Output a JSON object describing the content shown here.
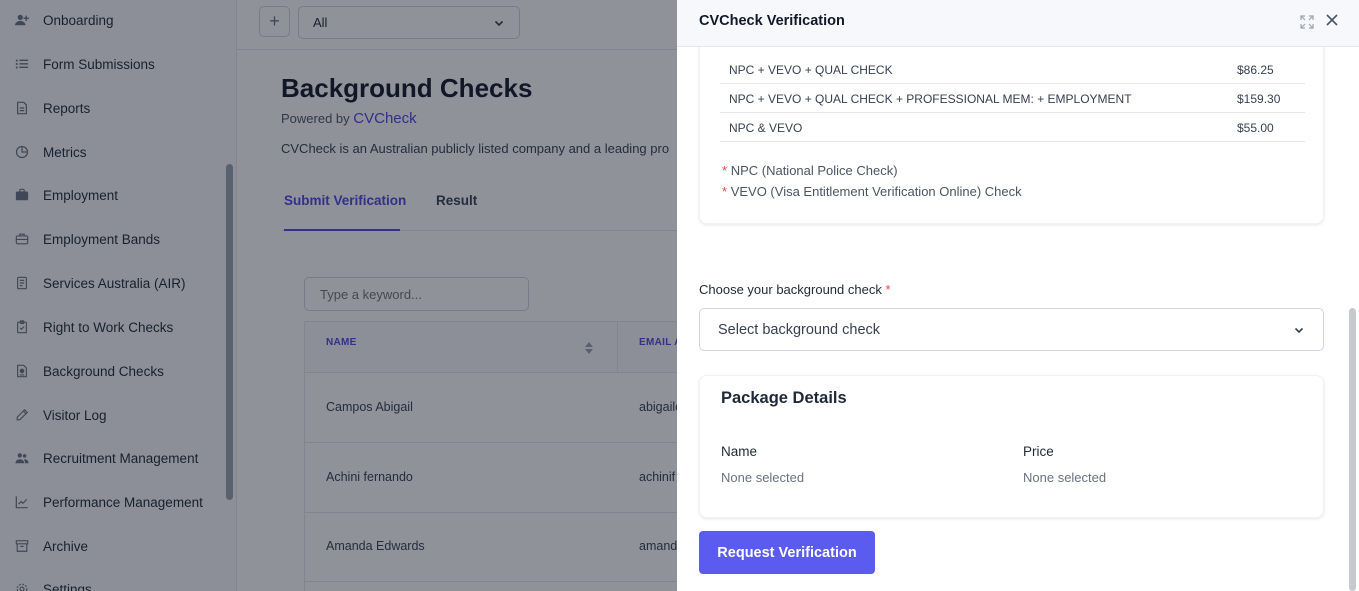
{
  "sidebar": {
    "items": [
      {
        "label": "Onboarding",
        "icon": "user-plus-icon"
      },
      {
        "label": "Form Submissions",
        "icon": "list-icon"
      },
      {
        "label": "Reports",
        "icon": "document-icon"
      },
      {
        "label": "Metrics",
        "icon": "pie-chart-icon"
      },
      {
        "label": "Employment",
        "icon": "briefcase-icon"
      },
      {
        "label": "Employment Bands",
        "icon": "briefcase-outline-icon"
      },
      {
        "label": "Services Australia (AIR)",
        "icon": "document-list-icon"
      },
      {
        "label": "Right to Work Checks",
        "icon": "clipboard-check-icon"
      },
      {
        "label": "Background Checks",
        "icon": "badge-document-icon"
      },
      {
        "label": "Visitor Log",
        "icon": "pencil-icon"
      },
      {
        "label": "Recruitment Management",
        "icon": "users-icon"
      },
      {
        "label": "Performance Management",
        "icon": "trending-up-icon"
      },
      {
        "label": "Archive",
        "icon": "archive-icon"
      },
      {
        "label": "Settings",
        "icon": "gear-icon"
      }
    ]
  },
  "topbar": {
    "plus_label": "+",
    "filter_value": "All"
  },
  "page": {
    "title": "Background Checks",
    "powered_prefix": "Powered by",
    "powered_link": "CVCheck",
    "description": "CVCheck is an Australian publicly listed company and a leading pro",
    "tabs": [
      "Submit Verification",
      "Result"
    ]
  },
  "search": {
    "placeholder": "Type a keyword..."
  },
  "table": {
    "headers": [
      "NAME",
      "EMAIL A"
    ],
    "rows": [
      {
        "name": "Campos Abigail",
        "email": "abigailc"
      },
      {
        "name": "Achini fernando",
        "email": "achinif"
      },
      {
        "name": "Amanda Edwards",
        "email": "amanda"
      }
    ]
  },
  "drawer": {
    "title": "CVCheck Verification",
    "packages": [
      {
        "name": "NPC + VEVO + QUAL CHECK",
        "price": "$86.25"
      },
      {
        "name": "NPC + VEVO + QUAL CHECK + PROFESSIONAL MEM: + EMPLOYMENT",
        "price": "$159.30"
      },
      {
        "name": "NPC & VEVO",
        "price": "$55.00"
      }
    ],
    "notes": [
      {
        "star": "*",
        "text": "NPC (National Police Check)"
      },
      {
        "star": "*",
        "text": "VEVO (Visa Entitlement Verification Online) Check"
      }
    ],
    "choose_label": "Choose your background check",
    "required_mark": "*",
    "select_placeholder": "Select background check",
    "package_details": {
      "title": "Package Details",
      "name_label": "Name",
      "price_label": "Price",
      "name_value": "None selected",
      "price_value": "None selected"
    },
    "submit_label": "Request Verification"
  },
  "colors": {
    "accent": "#4f46e5",
    "button": "#5b5bf0",
    "required": "#ef4444",
    "overlay": "rgba(17,24,39,0.47)"
  }
}
